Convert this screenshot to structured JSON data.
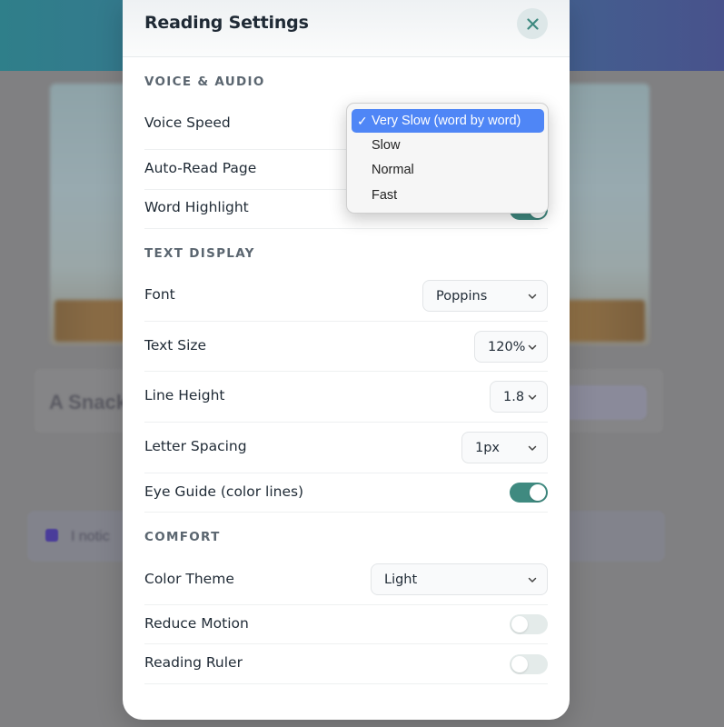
{
  "background": {
    "title": "A Snack",
    "banner_text": "I notic"
  },
  "modal": {
    "title": "Reading Settings",
    "close_icon": "close-icon"
  },
  "sections": {
    "voice_audio": "VOICE & AUDIO",
    "text_display": "TEXT DISPLAY",
    "comfort": "COMFORT"
  },
  "voice": {
    "voice_speed_label": "Voice Speed",
    "auto_read_label": "Auto-Read Page",
    "word_highlight_label": "Word Highlight",
    "word_highlight_on": true
  },
  "dropdown": {
    "options": [
      "Very Slow (word by word)",
      "Slow",
      "Normal",
      "Fast"
    ],
    "selected": "Very Slow (word by word)",
    "check_glyph": "✓"
  },
  "text_display": {
    "font_label": "Font",
    "font_value": "Poppins",
    "text_size_label": "Text Size",
    "text_size_value": "120%",
    "line_height_label": "Line Height",
    "line_height_value": "1.8",
    "letter_spacing_label": "Letter Spacing",
    "letter_spacing_value": "1px",
    "eye_guide_label": "Eye Guide (color lines)",
    "eye_guide_on": true
  },
  "comfort": {
    "color_theme_label": "Color Theme",
    "color_theme_value": "Light",
    "reduce_motion_label": "Reduce Motion",
    "reduce_motion_on": false,
    "reading_ruler_label": "Reading Ruler",
    "reading_ruler_on": false
  },
  "colors": {
    "toggle_on": "#3f8a80",
    "toggle_off": "#e4ebea",
    "dropdown_highlight": "#4f86f6",
    "header_gradient_start": "#2f7f8a",
    "header_gradient_end": "#48528c"
  }
}
